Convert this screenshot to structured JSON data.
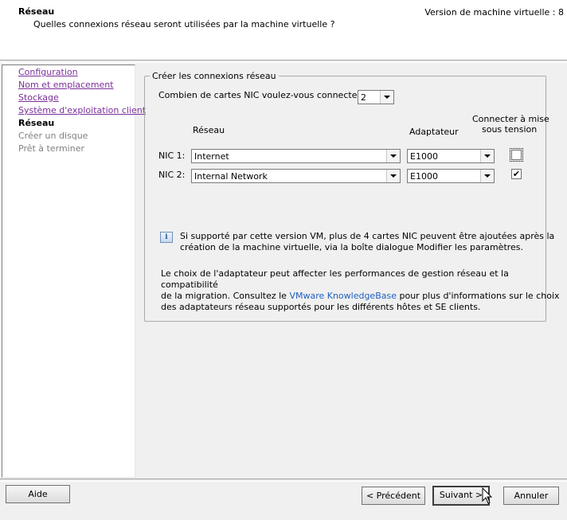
{
  "header": {
    "title": "Réseau",
    "subtitle": "Quelles connexions réseau seront utilisées par la machine virtuelle ?",
    "version": "Version de machine virtuelle : 8"
  },
  "sidebar": {
    "items": [
      {
        "label": "Configuration",
        "state": "link"
      },
      {
        "label": "Nom et emplacement",
        "state": "link"
      },
      {
        "label": "Stockage",
        "state": "link"
      },
      {
        "label": "Système d'exploitation client",
        "state": "link"
      },
      {
        "label": "Réseau",
        "state": "current"
      },
      {
        "label": "Créer un disque",
        "state": "disabled"
      },
      {
        "label": "Prêt à terminer",
        "state": "disabled"
      }
    ]
  },
  "main": {
    "group_title": "Créer les connexions réseau",
    "nic_count_label": "Combien de cartes NIC voulez-vous connecter ?",
    "nic_count_value": "2",
    "col_network": "Réseau",
    "col_adapter": "Adaptateur",
    "col_connect_line1": "Connecter à mise",
    "col_connect_line2": "sous tension",
    "nics": [
      {
        "label": "NIC 1:",
        "network": "Internet",
        "adapter": "E1000",
        "connect": false
      },
      {
        "label": "NIC 2:",
        "network": "Internal Network",
        "adapter": "E1000",
        "connect": true
      }
    ],
    "info_line1": "Si supporté par cette version VM, plus de 4 cartes NIC peuvent être ajoutées après la",
    "info_line2": "création de la machine virtuelle, via la boîte dialogue Modifier les paramètres.",
    "note_line1": "Le choix de l'adaptateur peut affecter les performances de gestion réseau et la compatibilité",
    "note_line2_pre": "de la migration. Consultez le ",
    "note_link": "VMware KnowledgeBase",
    "note_line2_post": " pour plus d'informations sur le choix",
    "note_line3": "des adaptateurs réseau supportés pour les différents hôtes et SE clients."
  },
  "buttons": {
    "help": "Aide",
    "back": "< Précédent",
    "next": "Suivant >",
    "cancel": "Annuler"
  },
  "colors": {
    "link_visited": "#7b2e9a",
    "kb_link": "#1f5fbf",
    "disabled_text": "#808080"
  }
}
